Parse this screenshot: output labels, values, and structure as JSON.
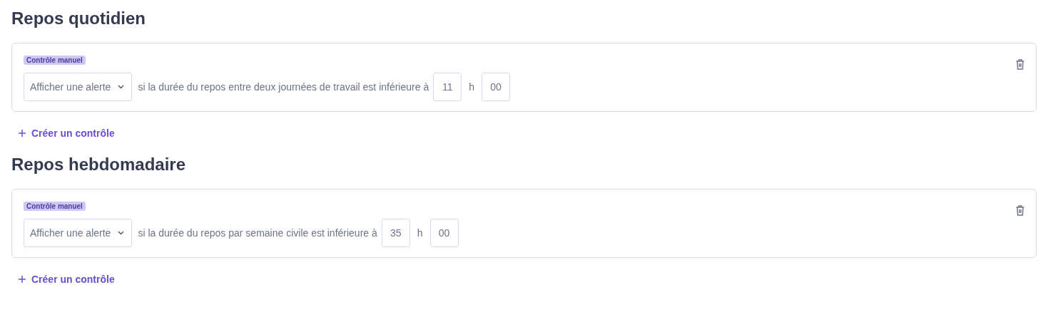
{
  "sections": [
    {
      "title": "Repos quotidien",
      "rules": [
        {
          "badge": "Contrôle manuel",
          "action": "Afficher une alerte",
          "condition": "si la durée du repos entre deux journées de travail est inférieure à",
          "hours": "11",
          "unit": "h",
          "minutes": "00"
        }
      ],
      "add_label": "Créer un contrôle"
    },
    {
      "title": "Repos hebdomadaire",
      "rules": [
        {
          "badge": "Contrôle manuel",
          "action": "Afficher une alerte",
          "condition": "si la durée du repos par semaine civile est inférieure à",
          "hours": "35",
          "unit": "h",
          "minutes": "00"
        }
      ],
      "add_label": "Créer un contrôle"
    }
  ]
}
